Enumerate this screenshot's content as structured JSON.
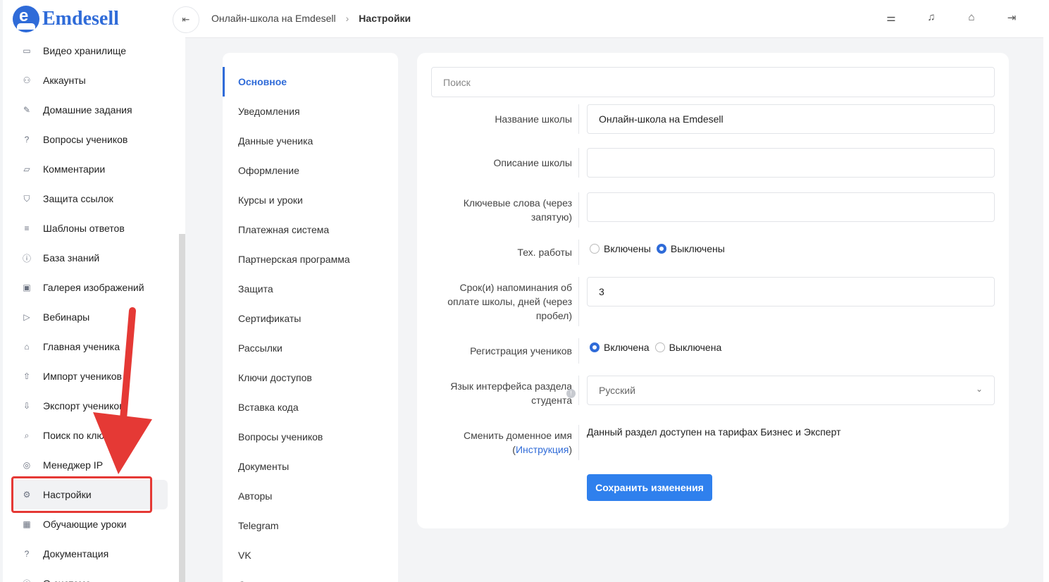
{
  "brand": {
    "name": "Emdesell",
    "logo_letter": "e",
    "color": "#2f6bd8"
  },
  "sidebar": {
    "items": [
      {
        "label": "Видео хранилище",
        "icon": "video-icon",
        "glyph": "▭"
      },
      {
        "label": "Аккаунты",
        "icon": "users-icon",
        "glyph": "⚇"
      },
      {
        "label": "Домашние задания",
        "icon": "pencil-icon",
        "glyph": "✎"
      },
      {
        "label": "Вопросы учеников",
        "icon": "question-icon",
        "glyph": "?"
      },
      {
        "label": "Комментарии",
        "icon": "comment-icon",
        "glyph": "▱"
      },
      {
        "label": "Защита ссылок",
        "icon": "shield-icon",
        "glyph": "⛉"
      },
      {
        "label": "Шаблоны ответов",
        "icon": "list-icon",
        "glyph": "≡"
      },
      {
        "label": "База знаний",
        "icon": "info-icon",
        "glyph": "ⓘ"
      },
      {
        "label": "Галерея изображений",
        "icon": "image-icon",
        "glyph": "▣"
      },
      {
        "label": "Вебинары",
        "icon": "play-icon",
        "glyph": "▷"
      },
      {
        "label": "Главная ученика",
        "icon": "home-icon",
        "glyph": "⌂"
      },
      {
        "label": "Импорт учеников",
        "icon": "upload-icon",
        "glyph": "⇧"
      },
      {
        "label": "Экспорт учеников",
        "icon": "download-icon",
        "glyph": "⇩"
      },
      {
        "label": "Поиск по ключу",
        "icon": "search-icon",
        "glyph": "⌕"
      },
      {
        "label": "Менеджер IP",
        "icon": "target-icon",
        "glyph": "◎"
      },
      {
        "label": "Настройки",
        "icon": "gear-icon",
        "glyph": "⚙"
      },
      {
        "label": "Обучающие уроки",
        "icon": "film-icon",
        "glyph": "▦"
      },
      {
        "label": "Документация",
        "icon": "help-icon",
        "glyph": "?"
      },
      {
        "label": "О системе",
        "icon": "about-icon",
        "glyph": "ⓘ"
      }
    ],
    "active_index": 15
  },
  "topbar": {
    "crumb_root": "Онлайн-школа на Emdesell",
    "crumb_sep": "›",
    "crumb_current": "Настройки",
    "collapse_glyph": "⇤",
    "icons": [
      {
        "name": "sliders-icon",
        "glyph": "⚌"
      },
      {
        "name": "bell-icon",
        "glyph": "♫"
      },
      {
        "name": "home-settings-icon",
        "glyph": "⌂"
      },
      {
        "name": "logout-icon",
        "glyph": "⇥"
      }
    ]
  },
  "settings_menu": {
    "items": [
      "Основное",
      "Уведомления",
      "Данные ученика",
      "Оформление",
      "Курсы и уроки",
      "Платежная система",
      "Партнерская программа",
      "Защита",
      "Сертификаты",
      "Рассылки",
      "Ключи доступов",
      "Вставка кода",
      "Вопросы учеников",
      "Документы",
      "Авторы",
      "Telegram",
      "VK",
      "Остальное"
    ],
    "active_index": 0
  },
  "form": {
    "search_placeholder": "Поиск",
    "school_name_label": "Название школы",
    "school_name_value": "Онлайн-школа на Emdesell",
    "school_desc_label": "Описание школы",
    "school_desc_value": "",
    "keywords_label_1": "Ключевые слова (через",
    "keywords_label_2": "запятую)",
    "keywords_value": "",
    "maintenance_label": "Тех. работы",
    "maintenance_on": "Включены",
    "maintenance_off": "Выключены",
    "maintenance_selected": "Выключены",
    "reminder_label_1": "Срок(и) напоминания об",
    "reminder_label_2": "оплате школы, дней (через",
    "reminder_label_3": "пробел)",
    "reminder_value": "3",
    "registration_label": "Регистрация учеников",
    "registration_on": "Включена",
    "registration_off": "Выключена",
    "registration_selected": "Включена",
    "lang_label_1": "Язык интерфейса раздела",
    "lang_label_2": "студента",
    "lang_value": "Русский",
    "domain_label": "Сменить доменное имя",
    "domain_link": "Инструкция",
    "domain_note": "Данный раздел доступен на тарифах Бизнес и Эксперт",
    "save_label": "Сохранить изменения"
  },
  "colors": {
    "accent": "#2f80ed",
    "annotation": "#e53935"
  }
}
